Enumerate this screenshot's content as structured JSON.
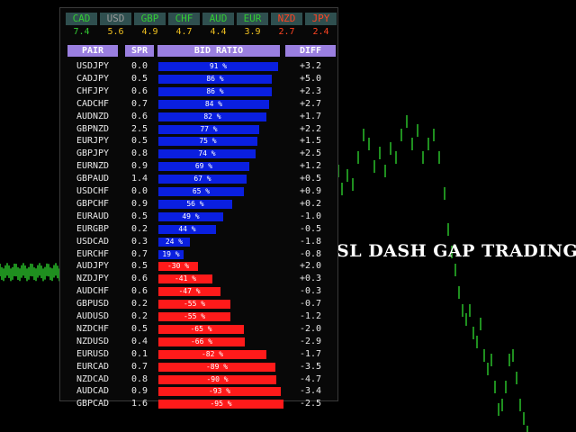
{
  "colors": {
    "bar_positive": "#0a1fe0",
    "bar_negative": "#ff1a1a",
    "header_bg": "#9a7fe0",
    "price_line": "#1f8f1f"
  },
  "currencies": [
    {
      "name": "CAD",
      "value": "7.4",
      "name_color": "#33cc33",
      "value_color": "#33cc33"
    },
    {
      "name": "USD",
      "value": "5.6",
      "name_color": "#9a9a9a",
      "value_color": "#f0c020"
    },
    {
      "name": "GBP",
      "value": "4.9",
      "name_color": "#33cc33",
      "value_color": "#f0c020"
    },
    {
      "name": "CHF",
      "value": "4.7",
      "name_color": "#33cc33",
      "value_color": "#f0c020"
    },
    {
      "name": "AUD",
      "value": "4.4",
      "name_color": "#33cc33",
      "value_color": "#f0c020"
    },
    {
      "name": "EUR",
      "value": "3.9",
      "name_color": "#33cc33",
      "value_color": "#f0c020"
    },
    {
      "name": "NZD",
      "value": "2.7",
      "name_color": "#ff4422",
      "value_color": "#ff4422"
    },
    {
      "name": "JPY",
      "value": "2.4",
      "name_color": "#ff4422",
      "value_color": "#ff4422"
    }
  ],
  "headers": {
    "pair": "PAIR",
    "spr": "SPR",
    "bid_ratio": "BID RATIO",
    "diff": "DIFF"
  },
  "pairs": [
    {
      "pair": "USDJPY",
      "spr": "0.0",
      "ratio": 91,
      "diff": "+3.2"
    },
    {
      "pair": "CADJPY",
      "spr": "0.5",
      "ratio": 86,
      "diff": "+5.0"
    },
    {
      "pair": "CHFJPY",
      "spr": "0.6",
      "ratio": 86,
      "diff": "+2.3"
    },
    {
      "pair": "CADCHF",
      "spr": "0.7",
      "ratio": 84,
      "diff": "+2.7"
    },
    {
      "pair": "AUDNZD",
      "spr": "0.6",
      "ratio": 82,
      "diff": "+1.7"
    },
    {
      "pair": "GBPNZD",
      "spr": "2.5",
      "ratio": 77,
      "diff": "+2.2"
    },
    {
      "pair": "EURJPY",
      "spr": "0.5",
      "ratio": 75,
      "diff": "+1.5"
    },
    {
      "pair": "GBPJPY",
      "spr": "0.8",
      "ratio": 74,
      "diff": "+2.5"
    },
    {
      "pair": "EURNZD",
      "spr": "0.9",
      "ratio": 69,
      "diff": "+1.2"
    },
    {
      "pair": "GBPAUD",
      "spr": "1.4",
      "ratio": 67,
      "diff": "+0.5"
    },
    {
      "pair": "USDCHF",
      "spr": "0.0",
      "ratio": 65,
      "diff": "+0.9"
    },
    {
      "pair": "GBPCHF",
      "spr": "0.9",
      "ratio": 56,
      "diff": "+0.2"
    },
    {
      "pair": "EURAUD",
      "spr": "0.5",
      "ratio": 49,
      "diff": "-1.0"
    },
    {
      "pair": "EURGBP",
      "spr": "0.2",
      "ratio": 44,
      "diff": "-0.5"
    },
    {
      "pair": "USDCAD",
      "spr": "0.3",
      "ratio": 24,
      "diff": "-1.8"
    },
    {
      "pair": "EURCHF",
      "spr": "0.7",
      "ratio": 19,
      "diff": "-0.8"
    },
    {
      "pair": "AUDJPY",
      "spr": "0.5",
      "ratio": -30,
      "diff": "+2.0"
    },
    {
      "pair": "NZDJPY",
      "spr": "0.6",
      "ratio": -41,
      "diff": "+0.3"
    },
    {
      "pair": "AUDCHF",
      "spr": "0.6",
      "ratio": -47,
      "diff": "-0.3"
    },
    {
      "pair": "GBPUSD",
      "spr": "0.2",
      "ratio": -55,
      "diff": "-0.7"
    },
    {
      "pair": "AUDUSD",
      "spr": "0.2",
      "ratio": -55,
      "diff": "-1.2"
    },
    {
      "pair": "NZDCHF",
      "spr": "0.5",
      "ratio": -65,
      "diff": "-2.0"
    },
    {
      "pair": "NZDUSD",
      "spr": "0.4",
      "ratio": -66,
      "diff": "-2.9"
    },
    {
      "pair": "EURUSD",
      "spr": "0.1",
      "ratio": -82,
      "diff": "-1.7"
    },
    {
      "pair": "EURCAD",
      "spr": "0.7",
      "ratio": -89,
      "diff": "-3.5"
    },
    {
      "pair": "NZDCAD",
      "spr": "0.8",
      "ratio": -90,
      "diff": "-4.7"
    },
    {
      "pair": "AUDCAD",
      "spr": "0.9",
      "ratio": -93,
      "diff": "-3.4"
    },
    {
      "pair": "GBPCAD",
      "spr": "1.6",
      "ratio": -95,
      "diff": "-2.5"
    }
  ],
  "watermark": "SL DASH GAP TRADING"
}
